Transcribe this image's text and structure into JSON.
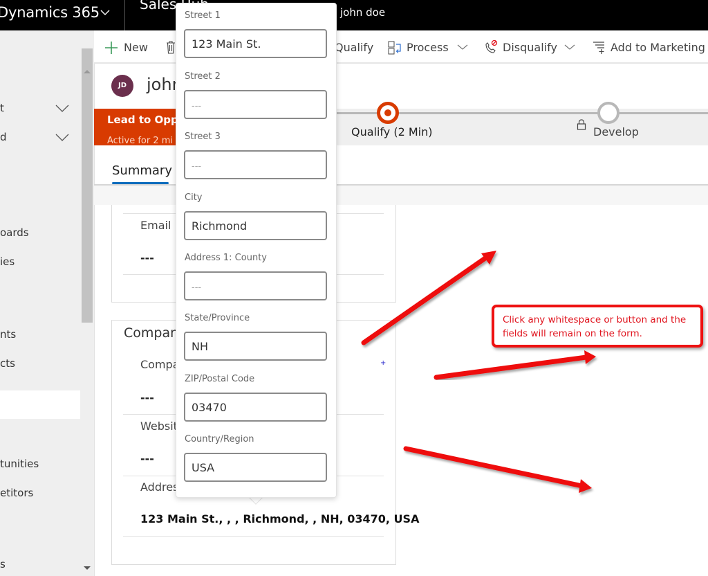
{
  "topbar": {
    "app_title": "Dynamics 365",
    "app_name": "Sales Hub",
    "user": "john doe"
  },
  "sidebar": {
    "items": [
      {
        "label": "t",
        "expandable": true
      },
      {
        "label": "d",
        "expandable": true
      },
      {
        "label": "oards"
      },
      {
        "label": "ies"
      },
      {
        "label": "nts"
      },
      {
        "label": "cts"
      },
      {
        "label": "",
        "selected": true
      },
      {
        "label": "tunities"
      },
      {
        "label": "etitors"
      },
      {
        "label": "s"
      }
    ]
  },
  "command_bar": {
    "new": "New",
    "qualify": "Qualify",
    "process": "Process",
    "disqualify": "Disqualify",
    "add_to_marketing": "Add to Marketing L"
  },
  "header": {
    "avatar_initials": "JD",
    "record_name": "john"
  },
  "process": {
    "flyout_title": "Lead to Oppo",
    "flyout_sub": "Active for 2 mi",
    "stages": [
      {
        "label": "Qualify  (2 Min)",
        "state": "active"
      },
      {
        "label": "Develop",
        "state": "locked"
      }
    ],
    "active_color": "#d83b01"
  },
  "tabs": {
    "summary": "Summary"
  },
  "contact_section": {
    "email_label": "Email",
    "email_value": "---"
  },
  "company_section": {
    "title": "Compan",
    "company_label": "Compa",
    "company_value": "---",
    "website_label": "Websit",
    "website_value": "---",
    "address_label": "Addres",
    "address_value": "123 Main St., , , Richmond, , NH, 03470, USA"
  },
  "address_popup": {
    "fields": [
      {
        "label": "Street 1",
        "value": "123 Main St.",
        "placeholder": "---"
      },
      {
        "label": "Street 2",
        "value": "",
        "placeholder": "---"
      },
      {
        "label": "Street 3",
        "value": "",
        "placeholder": "---"
      },
      {
        "label": "City",
        "value": "Richmond",
        "placeholder": "---"
      },
      {
        "label": "Address 1: County",
        "value": "",
        "placeholder": "---"
      },
      {
        "label": "State/Province",
        "value": "NH",
        "placeholder": "---"
      },
      {
        "label": "ZIP/Postal Code",
        "value": "03470",
        "placeholder": "---"
      },
      {
        "label": "Country/Region",
        "value": "USA",
        "placeholder": "---"
      }
    ]
  },
  "annotation": {
    "text": "Click any whitespace or button and the fields will remain on the form.",
    "color": "#ee1111"
  }
}
